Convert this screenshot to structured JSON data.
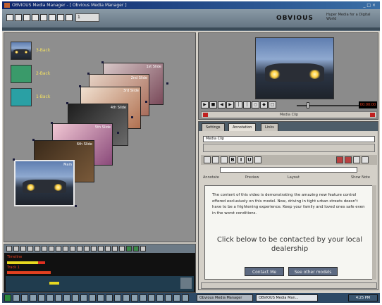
{
  "window": {
    "title": "OBVIOUS Media Manager - [ Obvious Media Manager ]",
    "title_right": "_ □ ×"
  },
  "toolbar": {
    "field_value": "1",
    "brand": "OBVIOUS",
    "brand_sub": "Hyper Media for a Digital World"
  },
  "layers": [
    {
      "label": "3-Back"
    },
    {
      "label": "2-Back"
    },
    {
      "label": "1-Back"
    }
  ],
  "slides": [
    {
      "caption": "1st Slide"
    },
    {
      "caption": "2nd Slide"
    },
    {
      "caption": "3rd Slide"
    },
    {
      "caption": "4th Slide"
    },
    {
      "caption": "5th Slide"
    },
    {
      "caption": "6th Slide"
    },
    {
      "caption": "Main"
    }
  ],
  "timeline": {
    "labels": [
      "Timeline",
      "Track 1"
    ]
  },
  "preview": {
    "time": "00:00:00",
    "clip_name": "Media Clip"
  },
  "properties": {
    "tabs": [
      "Settings",
      "Annotation",
      "Links"
    ],
    "field1": "Media Clip",
    "options": [
      "Annotate",
      "Preview",
      "Layout",
      "Show Note"
    ],
    "paragraph": "The content of this video is demonstrating the amazing new feature control offered exclusively on this model. Now, driving in tight urban streets doesn't have to be a frightening experience. Keep your family and loved ones safe even in the worst conditions.",
    "headline": "Click below to be contacted by your local dealership",
    "buttons": [
      "Contact Me",
      "See other models"
    ]
  },
  "taskbar": {
    "tasks": [
      "Obvious Media Manager",
      "OBVIOUS Media Man..."
    ],
    "clock": "4:25 PM"
  },
  "colors": {
    "canvas_bg": "#8e8e8e",
    "accent_button": "#5d6a82",
    "timeline_bg": "#111111"
  }
}
